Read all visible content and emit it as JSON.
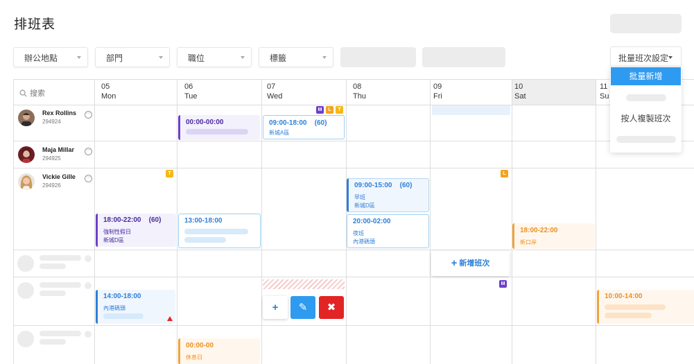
{
  "page": {
    "title": "排班表"
  },
  "filters": [
    {
      "label": "辦公地點"
    },
    {
      "label": "部門"
    },
    {
      "label": "職位"
    },
    {
      "label": "標籤"
    }
  ],
  "batch": {
    "label": "批量班次設定",
    "menu": {
      "batch_add": "批量新增",
      "copy_by_person": "按人複製班次"
    }
  },
  "search": {
    "label": "搜索"
  },
  "days": [
    {
      "num": "05",
      "name": "Mon"
    },
    {
      "num": "06",
      "name": "Tue"
    },
    {
      "num": "07",
      "name": "Wed"
    },
    {
      "num": "08",
      "name": "Thu"
    },
    {
      "num": "09",
      "name": "Fri"
    },
    {
      "num": "10",
      "name": "Sat"
    },
    {
      "num": "11",
      "name": "Su"
    }
  ],
  "employees": [
    {
      "name": "Rex Rollins",
      "id": "294924"
    },
    {
      "name": "Maja Millar",
      "id": "294925"
    },
    {
      "name": "Vickie Gille",
      "id": "294926"
    }
  ],
  "more_label": "···",
  "shifts": {
    "rex_tue": {
      "time": "00:00-00:00"
    },
    "rex_wed": {
      "time": "09:00-18:00",
      "hours": "(60)",
      "location": "新城A區"
    },
    "vickie_mon": {
      "time": "18:00-22:00",
      "hours": "(60)",
      "type": "強制性假日",
      "location": "新城D區"
    },
    "vickie_tue": {
      "time": "13:00-18:00"
    },
    "vickie_thu_1": {
      "time": "09:00-15:00",
      "hours": "(60)",
      "type": "早班",
      "location": "新城D區"
    },
    "vickie_thu_2": {
      "time": "20:00-02:00",
      "type": "夜班",
      "location": "內港碼頭"
    },
    "vickie_sat": {
      "time": "18:00-22:00",
      "location": "新口岸"
    },
    "row5_mon": {
      "time": "14:00-18:00",
      "location": "內港碼頭"
    },
    "row5_sun": {
      "time": "10:00-14:00"
    },
    "row6_tue": {
      "time": "00:00-00",
      "type": "休息日"
    }
  },
  "tags": {
    "m": "M",
    "l": "L",
    "t": "T"
  },
  "add_shift": {
    "plus": "+",
    "label": "新增班次"
  },
  "actions": {
    "add": "+",
    "edit": "✎",
    "delete": "✖"
  },
  "colors": {
    "purple": "#6d3fc7",
    "blue": "#2e7fd8",
    "orange": "#f1a43c",
    "red": "#e32424",
    "primary": "#2f9bf0"
  }
}
